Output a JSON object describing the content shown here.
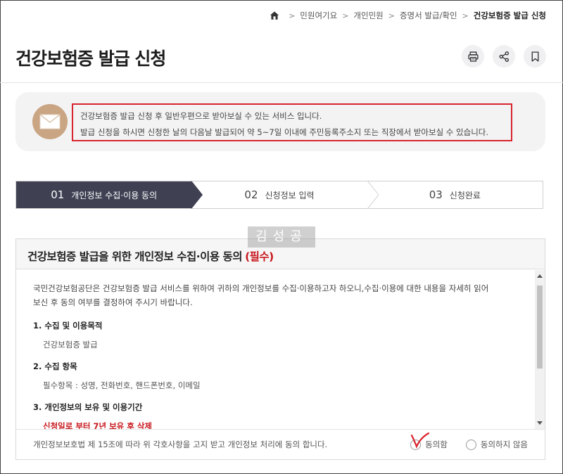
{
  "breadcrumb": {
    "items": [
      "민원여기요",
      "개인민원",
      "증명서 발급/확인"
    ],
    "current": "건강보험증 발급 신청"
  },
  "page": {
    "title": "건강보험증 발급 신청"
  },
  "notice": {
    "line1": "건강보험증 발급 신청 후 일반우편으로 받아보실 수 있는 서비스 입니다.",
    "line2": "발급 신청을 하시면 신청한 날의 다음날 발급되어 약 5~7일 이내에 주민등록주소지 또는 직장에서 받아보실 수 있습니다."
  },
  "steps": [
    {
      "num": "01",
      "label": "개인정보 수집·이용 동의"
    },
    {
      "num": "02",
      "label": "신청정보 입력"
    },
    {
      "num": "03",
      "label": "신청완료"
    }
  ],
  "watermark": "김성공",
  "consent": {
    "title": "건강보험증 발급을 위한 개인정보 수집·이용 동의",
    "required": "(필수)",
    "intro_line1": "국민건강보험공단은 건강보험증 발급 서비스를 위하여 귀하의 개인정보를 수집·이용하고자 하오니,수집·이용에 대한 내용을 자세히 읽어",
    "intro_line2": "보신 후 동의 여부를 결정하여 주시기 바랍니다.",
    "sections": [
      {
        "title": "1. 수집 및 이용목적",
        "value": "건강보험증 발급"
      },
      {
        "title": "2. 수집 항목",
        "value": "필수항목 : 성명, 전화번호, 핸드폰번호, 이메일"
      },
      {
        "title": "3. 개인정보의 보유 및 이용기간",
        "value": "신청일로 부터 7년 보유 후 삭제"
      }
    ],
    "law_text": "개인정보보호법 제 15조에 따라 위 각호사항을 고지 받고 개인정보 처리에 동의 합니다.",
    "agree_label": "동의함",
    "disagree_label": "동의하지 않음"
  },
  "colors": {
    "active_step": "#3f4153",
    "accent_red": "#c8181e",
    "notice_border": "#d8242e",
    "mail_circle": "#c9a583"
  }
}
